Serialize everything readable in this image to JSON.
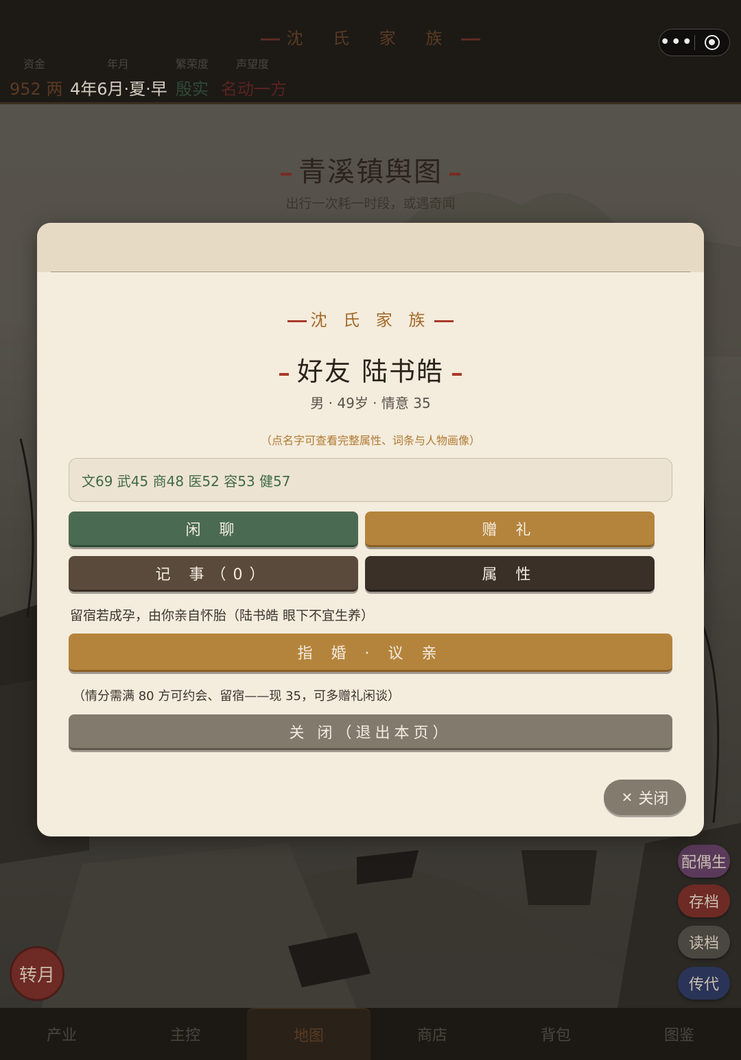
{
  "topbar": {
    "family_title": "沈 氏 家 族",
    "stats": [
      {
        "label": "资金",
        "value": "952 两",
        "color": "#5a3a22"
      },
      {
        "label": "年月",
        "value": "4年6月·夏·早",
        "color": "#d6cdbf"
      },
      {
        "label": "繁荣度",
        "value": "殷实",
        "color": "#2f4a36"
      },
      {
        "label": "声望度",
        "value": "名动一方",
        "color": "#5a2222"
      }
    ]
  },
  "map": {
    "title": "青溪镇舆图",
    "subtitle": "出行一次耗一时段，或遇奇闻"
  },
  "modal": {
    "family": "沈 氏 家 族",
    "name": "好友 陆书皓",
    "info": "男 · 49岁 · 情意 35",
    "hint": "（点名字可查看完整属性、词条与人物画像）",
    "attributes": "文69 武45 商48 医52 容53 健57",
    "buttons": {
      "chat": "闲 聊",
      "gift": "赠 礼",
      "notes": "记 事（0）",
      "attributes": "属 性",
      "matchmaking": "指 婚 · 议 亲",
      "close_page": "关 闭（退出本页）",
      "close": "关闭"
    },
    "pregnancy_note": "留宿若成孕，由你亲自怀胎（陆书皓 眼下不宜生养）",
    "affection_note": "（情分需满 80 方可约会、留宿——现 35，可多赠礼闲谈）"
  },
  "side_buttons": [
    {
      "label": "配偶生",
      "color": "#5a3a5a"
    },
    {
      "label": "存档",
      "color": "#6e2a24"
    },
    {
      "label": "读档",
      "color": "#4a4640"
    },
    {
      "label": "传代",
      "color": "#2a3458"
    }
  ],
  "turn_button": "转月",
  "bottom_nav": [
    {
      "label": "产业"
    },
    {
      "label": "主控"
    },
    {
      "label": "地图"
    },
    {
      "label": "商店"
    },
    {
      "label": "背包"
    },
    {
      "label": "图鉴"
    }
  ]
}
